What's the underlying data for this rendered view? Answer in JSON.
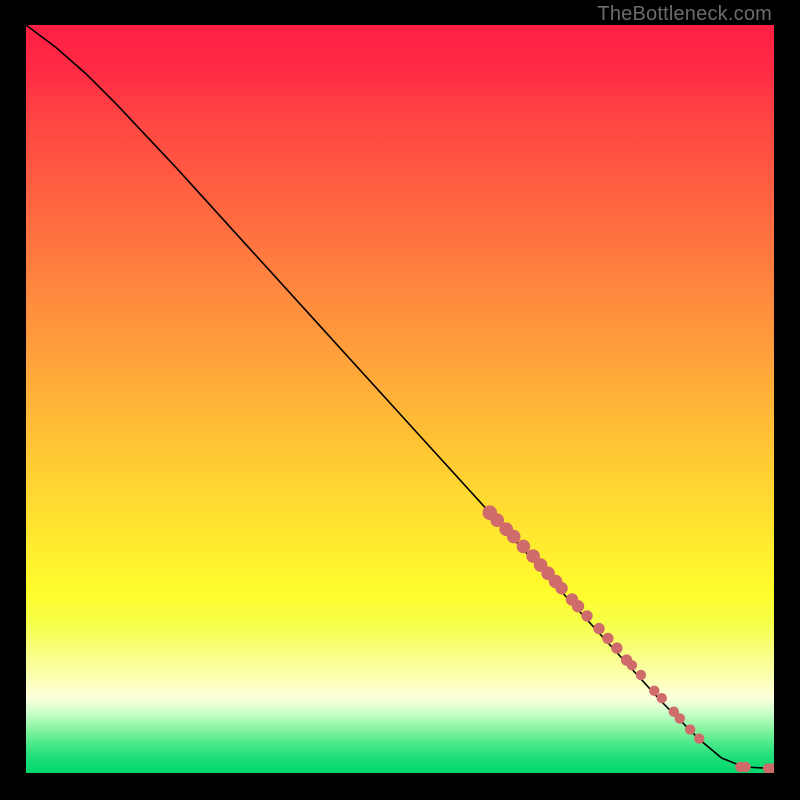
{
  "watermark": "TheBottleneck.com",
  "chart_data": {
    "type": "line",
    "title": "",
    "xlabel": "",
    "ylabel": "",
    "xlim": [
      0,
      100
    ],
    "ylim": [
      0,
      100
    ],
    "curve": [
      {
        "x": 0,
        "y": 100
      },
      {
        "x": 4,
        "y": 97
      },
      {
        "x": 8,
        "y": 93.5
      },
      {
        "x": 12,
        "y": 89.5
      },
      {
        "x": 20,
        "y": 81
      },
      {
        "x": 30,
        "y": 70
      },
      {
        "x": 40,
        "y": 59
      },
      {
        "x": 50,
        "y": 48
      },
      {
        "x": 60,
        "y": 37
      },
      {
        "x": 65,
        "y": 31.5
      },
      {
        "x": 70,
        "y": 26
      },
      {
        "x": 75,
        "y": 20.5
      },
      {
        "x": 80,
        "y": 15
      },
      {
        "x": 85,
        "y": 9.5
      },
      {
        "x": 90,
        "y": 4.5
      },
      {
        "x": 93,
        "y": 2
      },
      {
        "x": 96,
        "y": 0.8
      },
      {
        "x": 100,
        "y": 0.6
      }
    ],
    "points": [
      {
        "x": 62.0,
        "y": 34.8,
        "r": 1.4
      },
      {
        "x": 63.0,
        "y": 33.8,
        "r": 1.3
      },
      {
        "x": 64.2,
        "y": 32.6,
        "r": 1.3
      },
      {
        "x": 65.2,
        "y": 31.6,
        "r": 1.3
      },
      {
        "x": 66.5,
        "y": 30.3,
        "r": 1.3
      },
      {
        "x": 67.8,
        "y": 29.0,
        "r": 1.3
      },
      {
        "x": 68.8,
        "y": 27.8,
        "r": 1.3
      },
      {
        "x": 69.8,
        "y": 26.7,
        "r": 1.3
      },
      {
        "x": 70.8,
        "y": 25.6,
        "r": 1.3
      },
      {
        "x": 71.6,
        "y": 24.7,
        "r": 1.2
      },
      {
        "x": 73.0,
        "y": 23.2,
        "r": 1.2
      },
      {
        "x": 73.8,
        "y": 22.3,
        "r": 1.2
      },
      {
        "x": 75.0,
        "y": 21.0,
        "r": 1.1
      },
      {
        "x": 76.6,
        "y": 19.3,
        "r": 1.1
      },
      {
        "x": 77.8,
        "y": 18.0,
        "r": 1.1
      },
      {
        "x": 79.0,
        "y": 16.7,
        "r": 1.1
      },
      {
        "x": 80.3,
        "y": 15.1,
        "r": 1.1
      },
      {
        "x": 81.0,
        "y": 14.4,
        "r": 1.0
      },
      {
        "x": 82.2,
        "y": 13.1,
        "r": 1.0
      },
      {
        "x": 84.0,
        "y": 11.0,
        "r": 1.0
      },
      {
        "x": 85.0,
        "y": 10.0,
        "r": 1.0
      },
      {
        "x": 86.6,
        "y": 8.2,
        "r": 1.0
      },
      {
        "x": 87.4,
        "y": 7.3,
        "r": 1.0
      },
      {
        "x": 88.8,
        "y": 5.8,
        "r": 1.0
      },
      {
        "x": 90.0,
        "y": 4.6,
        "r": 1.0
      },
      {
        "x": 95.5,
        "y": 0.8,
        "r": 1.0
      },
      {
        "x": 96.2,
        "y": 0.8,
        "r": 1.0
      },
      {
        "x": 99.2,
        "y": 0.6,
        "r": 1.0
      },
      {
        "x": 99.8,
        "y": 0.6,
        "r": 1.0
      }
    ],
    "gradient": "rainbow-vertical"
  }
}
